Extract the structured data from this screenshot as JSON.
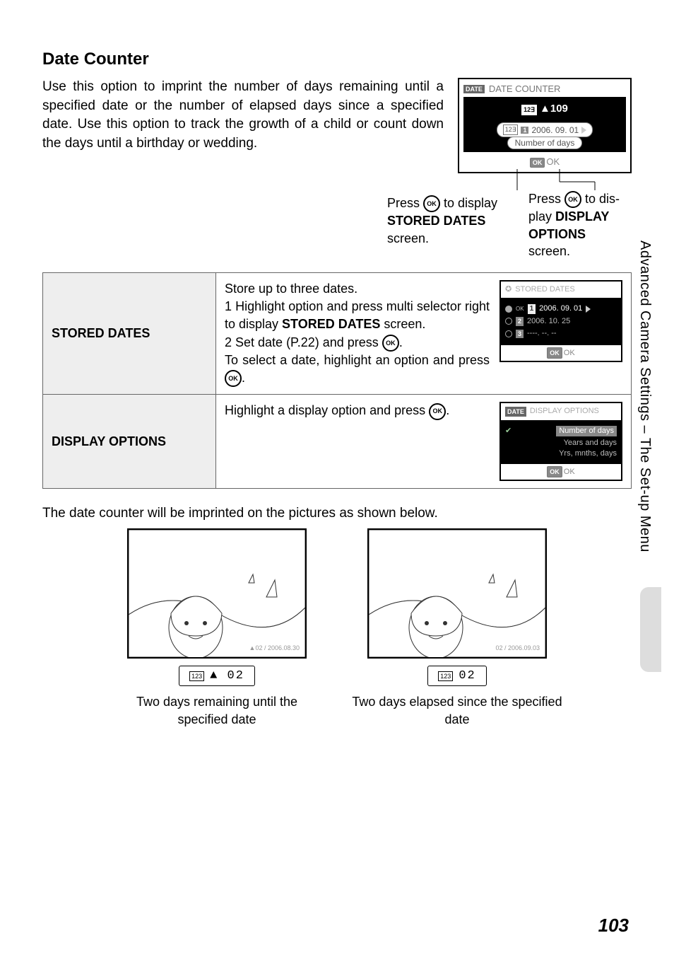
{
  "title": "Date Counter",
  "intro": "Use this option to imprint the number of days remaining until a specified date or the number of elapsed days since a specified date. Use this option to track the growth of a child or count down the days until a birthday or wedding.",
  "side_text": "Advanced Camera Settings – The Set-up Menu",
  "page_number": "103",
  "main_lcd": {
    "badge": "DATE",
    "title": "DATE COUNTER",
    "count": "▲109",
    "date_badge": "1",
    "date_value": "2006. 09. 01",
    "pill": "Number of days",
    "ok": "OK"
  },
  "leader_left": {
    "l1": "Press ",
    "l2": " to display",
    "l3": "STORED DATES",
    "l4": "screen."
  },
  "leader_right": {
    "l1": "Press ",
    "l2": " to dis-",
    "l3": "play ",
    "l4": "DISPLAY",
    "l5": "OPTIONS",
    "l6": "screen."
  },
  "table": {
    "row1": {
      "label": "STORED DATES",
      "t1": "Store up to three dates.",
      "t2": "1 Highlight option and press multi selector right to display ",
      "t2b": "STORED DATES",
      "t2c": " screen.",
      "t3a": "2 Set date (P.22) and press ",
      "t3b": ".",
      "t4a": "To select a date, highlight an option and press ",
      "t4b": ".",
      "lcd": {
        "title": "STORED DATES",
        "rows": [
          {
            "num": "1",
            "txt": "2006. 09. 01",
            "sel": true
          },
          {
            "num": "2",
            "txt": "2006. 10. 25",
            "sel": false
          },
          {
            "num": "3",
            "txt": "----. --. --",
            "sel": false
          }
        ],
        "ok": "OK"
      }
    },
    "row2": {
      "label": "DISPLAY OPTIONS",
      "t1a": "Highlight a display option and press ",
      "t1b": ".",
      "lcd": {
        "badge": "DATE",
        "title": "DISPLAY OPTIONS",
        "opts": [
          "Number of days",
          "Years and days",
          "Yrs, mnths, days"
        ],
        "ok": "OK"
      }
    }
  },
  "below_text": "The date counter will be imprinted on the pictures as shown below.",
  "examples": {
    "left": {
      "imprint": "▲02 / 2006.08.30",
      "callout_icon": "123",
      "callout_text": "▲ 02",
      "caption": "Two days remaining until the specified date"
    },
    "right": {
      "imprint": "02 / 2006.09.03",
      "callout_icon": "123",
      "callout_text": "02",
      "caption": "Two days elapsed since the specified date"
    }
  }
}
